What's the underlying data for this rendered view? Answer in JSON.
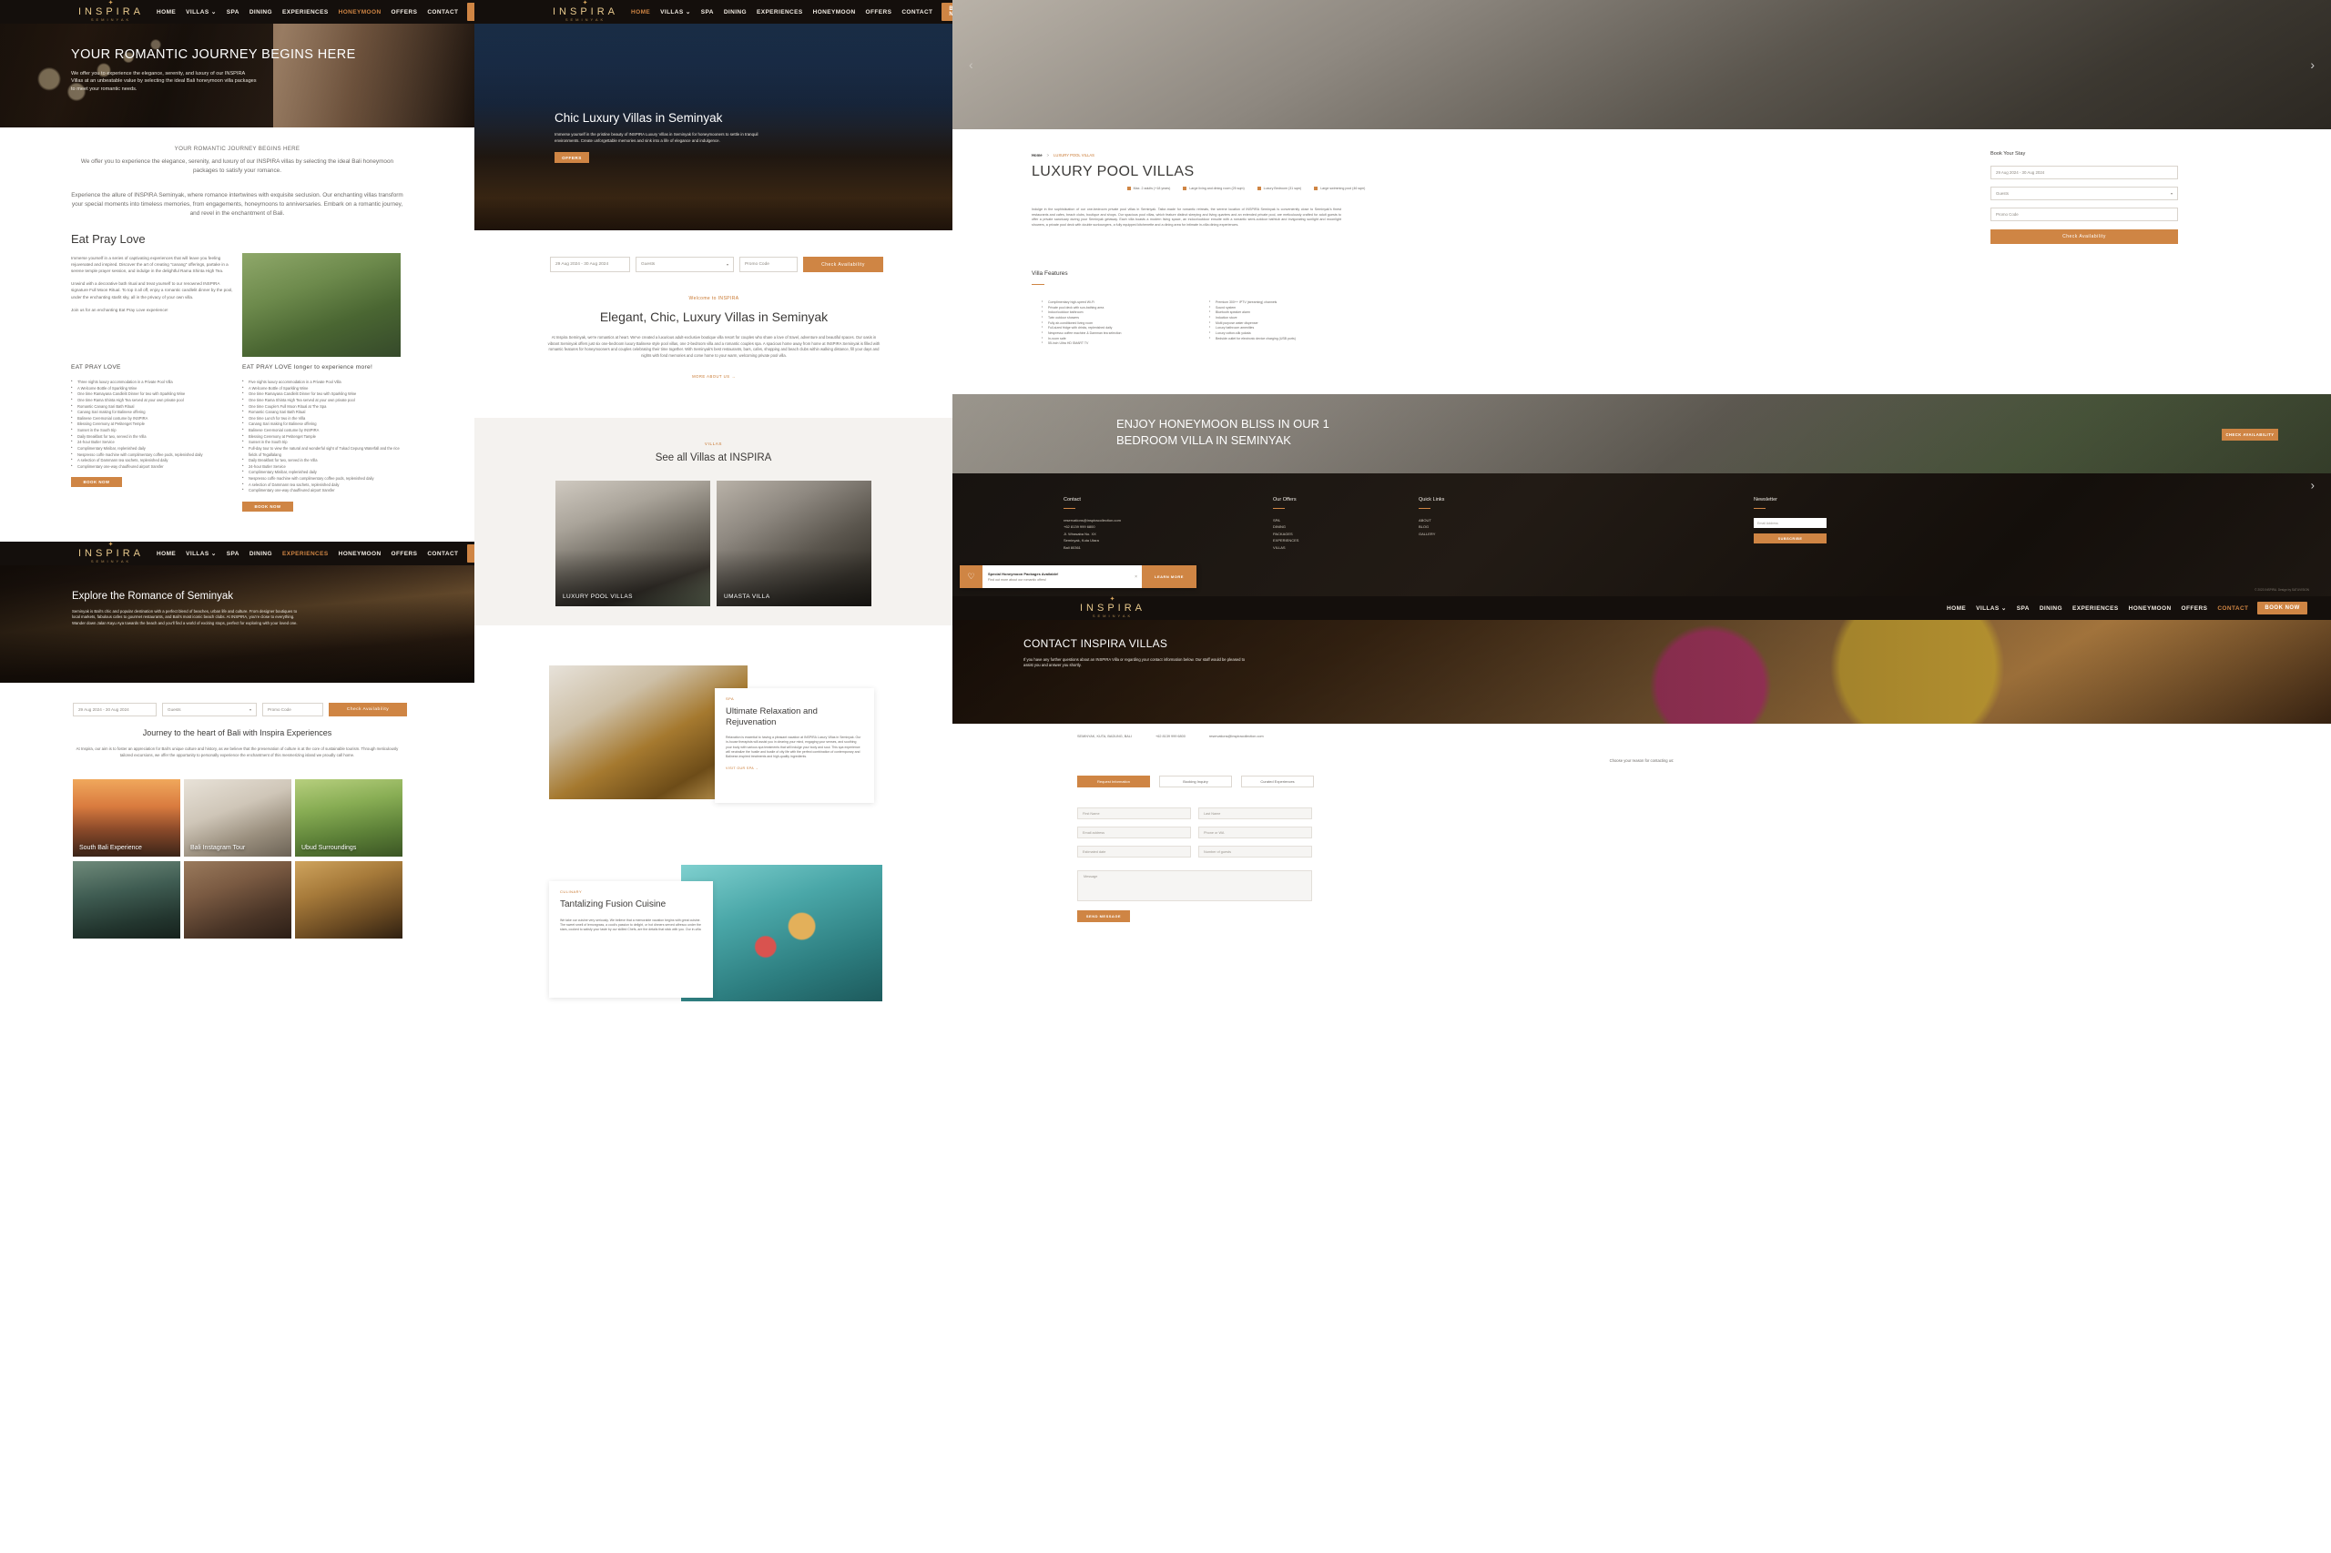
{
  "brand": {
    "name": "INSPIRA",
    "sub": "SEMINYAK",
    "mark": "✦"
  },
  "nav": {
    "items": [
      "HOME",
      "VILLAS",
      "SPA",
      "DINING",
      "EXPERIENCES",
      "HONEYMOON",
      "OFFERS",
      "CONTACT"
    ],
    "book_label": "BOOK NOW"
  },
  "panel_honeymoon": {
    "hero": {
      "title": "YOUR ROMANTIC JOURNEY BEGINS HERE",
      "paragraph": "We offer you to experience the elegance, serenity, and luxury of our INSPIRA Villas at an unbeatable value by selecting the ideal Bali honeymoon villa packages to meet your romantic needs."
    },
    "intro": {
      "eyebrow": "YOUR ROMANTIC JOURNEY BEGINS HERE",
      "p1": "We offer you to experience the elegance, serenity, and luxury of our INSPIRA villas by selecting the ideal Bali honeymoon packages to satisfy your romance.",
      "p2": "Experience the allure of INSPIRA Seminyak, where romance intertwines with exquisite seclusion. Our enchanting villas transform your special moments into timeless memories, from engagements, honeymoons to anniversaries. Embark on a romantic journey, and revel in the enchantment of Bali."
    },
    "eat_pray_love": {
      "heading": "Eat Pray Love",
      "p1": "Immerse yourself in a series of captivating experiences that will leave you feeling rejuvenated and inspired. Discover the art of creating \"canang\" offerings, partake in a serene temple prayer session, and indulge in the delightful Rama Shinta High Tea.",
      "p2": "Unwind with a decorative bath ritual and treat yourself to our renowned INSPIRA signature Full Moon Ritual. To top it all off, enjoy a romantic candlelit dinner by the pool, under the enchanting starlit sky, all in the privacy of your own villa.",
      "p3": "Join us for an enchanting Eat Pray Love experience!"
    },
    "package_a": {
      "title": "EAT PRAY LOVE",
      "items": [
        "Three nights luxury accommodation in a Private Pool Villa",
        "A Welcome Bottle of Sparkling Wine",
        "One time Ramayana Candlelit Dinner for two with Sparkling Wine",
        "One time Rama Shinta High Tea served at your own private pool",
        "Romantic Canang Sari Bath Ritual",
        "Canang Sari making for Balinese offering",
        "Balinese Ceremonial costume by INSPIRA",
        "Blessing Ceremony at Petitenget Temple",
        "Sunset in the South trip",
        "Daily Breakfast for two, served in the Villa",
        "24-hour Butler Service",
        "Complimentary Minibar, replenished daily",
        "Nespresso coffe machine with complimentary coffee pods, replenished daily",
        "A selection of Dammann tea sachets, replenished daily",
        "Complimentary one-way chauffeured airport transfer"
      ],
      "button": "BOOK NOW"
    },
    "package_b": {
      "title": "EAT PRAY LOVE longer to experience more!",
      "items": [
        "Five nights luxury accommodation in a Private Pool Villa",
        "A Welcome Bottle of Sparkling Wine",
        "One time Ramayana Candlelit Dinner for two with Sparkling Wine",
        "One time Rama Shinta High Tea served at your own private pool",
        "One time Couple's Full Moon Ritual at The Spa",
        "Romantic Canang Sari Bath Ritual",
        "One time Lunch for two in the Villa",
        "Canang Sari making for Balinese offering",
        "Balinese Ceremonial costume by INSPIRA",
        "Blessing Ceremony at Petitenget Tample",
        "Sunset in the South trip",
        "Full-day tour to view the natural and wonderful sight of Tukad Cepung Waterfall and the rice fields of Tegallalang",
        "Daily Breakfast for two, served in the Villa",
        "24-hour Butler Service",
        "Complimentary Minibar, replenished daily",
        "Nespresso coffe machine with complimentary coffee pods, replenished daily",
        "A selection of Dammann tea sachets, replenished daily",
        "Complimentary one-way chauffeured airport transfer"
      ],
      "button": "BOOK NOW"
    }
  },
  "panel_experiences": {
    "hero": {
      "title": "Explore the Romance of Seminyak",
      "paragraph": "Seminyak is Bali's chic and popular destination with a perfect blend of beaches, urban life and culture. From designer boutiques to local markets, fabulous cafes to gourmet restaurants, and Bali's most iconic beach clubs. At INSPIRA, you're close to everything. Wander down Jalan Kayu Aya towards the beach and you'll find a world of exciting stops, perfect for exploring with your loved one."
    },
    "booking": {
      "dates": "29 Aug 2024 - 30 Aug 2024",
      "guests": "Guests",
      "promo": "Promo Code",
      "submit": "Check Availability"
    },
    "section": {
      "heading": "Journey to the heart of Bali with Inspira Experiences",
      "paragraph": "At Inspira, our aim is to foster an appreciation for Bali's unique culture and history, as we believe that the preservation of culture is at the core of sustainable tourism. Through meticulously tailored excursions, we offer the opportunity to personally experience the enchantment of this mesmerizing island we proudly call home."
    },
    "cards": [
      {
        "title": "South Bali Experience",
        "art": "ph-sunset"
      },
      {
        "title": "Bali Instagram Tour",
        "art": "ph-wed"
      },
      {
        "title": "Ubud Surroundings",
        "art": "ph-rice"
      },
      {
        "title": "",
        "art": "ph-water"
      },
      {
        "title": "",
        "art": "ph-couple"
      },
      {
        "title": "",
        "art": "ph-dancer"
      }
    ]
  },
  "panel_home": {
    "hero": {
      "title": "Chic Luxury Villas in Seminyak",
      "paragraph": "Immerse yourself in the pristine beauty of INSPIRA Luxury Villas in Seminyak for honeymooners to settle in tranquil environments. Create unforgettable memories and sink into a life of elegance and indulgence.",
      "cta": "OFFERS"
    },
    "booking": {
      "dates": "29 Aug 2024 - 30 Aug 2024",
      "guests": "Guests",
      "promo": "Promo Code",
      "submit": "Check Availability"
    },
    "welcome": {
      "eyebrow": "Welcome to INSPIRA",
      "heading": "Elegant, Chic, Luxury Villas in Seminyak",
      "paragraph": "At Inspira Seminyak, we're romantics at heart. We've created a luxurious adult-exclusive boutique villa resort for couples who share a love of travel, adventure and beautiful spaces. Our oasis in vibrant Seminyak offers just six one-bedroom luxury Balinese style pool villas, one 2-bedroom villa and a romantic couples spa. A spacious home away from home at INSPIRA Seminyak is filled with romantic features for honeymooners and couples celebrating their time together. With Seminyak's best restaurants, bars, cafes, shopping and beach clubs within walking distance, fill your days and nights with fond memories and come home to your warm, welcoming private pool villa.",
      "link": "MORE ABOUT US  →"
    },
    "villas": {
      "eyebrow": "VILLAS",
      "heading": "See all Villas at INSPIRA",
      "cards": [
        {
          "title": "LUXURY POOL VILLAS",
          "art": "ph-room"
        },
        {
          "title": "UMASTA VILLA",
          "art": "ph-bed"
        }
      ]
    },
    "spa": {
      "eyebrow": "SPA",
      "heading": "Ultimate Relaxation and Rejuvenation",
      "paragraph": "Relaxation is essential to having a pleasant vacation at INSPIRA Luxury Villas in Seminyak. Our in-house therapists will assist you in clearing your mind, engaging your senses, and soothing your body with various spa treatments that will indulge your body and soul. This spa experience will neutralize the hustle and bustle of city life with the perfect combination of contemporary and Balinese-inspired treatments and high-quality ingredients.",
      "link": "VISIT OUR SPA  →"
    },
    "dining": {
      "eyebrow": "CULINARY",
      "heading": "Tantalizing Fusion Cuisine",
      "paragraph": "We take our cuisine very seriously. We believe that a memorable vacation begins with great cuisine. The sweet smell of lemongrass, a cook's passion to delight, or hot dinners served alfresco under the stars, cooked to satisfy your taste by our skilled Chefs, are the details that stick with you. Our in-villa"
    }
  },
  "panel_villa": {
    "breadcrumb": {
      "home": "Home",
      "sep": ">",
      "current": "LUXURY POOL VILLAS"
    },
    "title": "LUXURY POOL VILLAS",
    "specs": [
      "Max. 2 adults (+18 years)",
      "Large living and dining room (25 sqm)",
      "Luxury Bedroom (31 sqm)",
      "Large swimming pool (46 sqm)"
    ],
    "description": "Indulge in the sophistication of our one-bedroom private pool villas in Seminyak. Tailor-made for romantic retreats, the serene location of INSPIRA Seminyak is conveniently close to Seminyak's finest restaurants and cafes, beach clubs, boutique and shops. Our spacious pool villas, which feature distinct sleeping and living quarters and an extended private pool, are meticulously crafted for adult guests to offer a private sanctuary during your Seminyak getaway. Each villa boasts a modern living space, an indoor/outdoor ensuite with a romantic semi-outdoor bathtub and invigorating sunlight and moonlight showers, a private pool deck with double sunloungers, a fully equipped kitchenette and a dining area for intimate in-villa dining experiences.",
    "features_heading": "Villa Features",
    "features_left": [
      "Complimentary high-speed Wi-Fi",
      "Private pool deck with sun-bathing area",
      "Indoor/outdoor bathroom",
      "Twin outdoor showers",
      "Fully air-conditioned living room",
      "Full-sized fridge with drinks, replenished daily",
      "Nespresso coffee machine & Damman tea selection",
      "In-room safe",
      "55-inch Ultra HD SMART TV"
    ],
    "features_right": [
      "Premium 300++ IPTV (streaming) channels",
      "Sound system",
      "Bluetooth speaker alarm",
      "Induction stove",
      "Multi purpose water dispenser",
      "Luxury bathroom amenities",
      "Luxury cotton-silk yukata",
      "Bedside outlet for electronic device charging (USB ports)"
    ],
    "booking": {
      "heading": "Book Your Stay",
      "dates": "29 Aug 2024 - 30 Aug 2024",
      "guests": "Guests",
      "promo": "Promo Code",
      "submit": "Check Availability"
    }
  },
  "panel_banner": {
    "line1": "ENJOY HONEYMOON BLISS IN OUR 1",
    "line2": "BEDROOM VILLA IN SEMINYAK",
    "cta": "CHECK AVAILABILITY"
  },
  "footer": {
    "columns": [
      {
        "heading": "Contact",
        "items": [
          "reservations@inspiracollection.com",
          "+62 8139 999 6800",
          "Jl. Wirasaba No. XX",
          "Seminyak, Kuta Utara",
          "Bali 80361"
        ]
      },
      {
        "heading": "Our Offers",
        "items": [
          "SPA",
          "DINING",
          "PACKAGES",
          "EXPERIENCES",
          "VILLAS"
        ]
      },
      {
        "heading": "Quick Links",
        "items": [
          "ABOUT",
          "BLOG",
          "GALLERY"
        ]
      }
    ],
    "newsletter": {
      "heading": "Newsletter",
      "placeholder": "Email Address",
      "button": "SUBSCRIBE"
    },
    "copyright": "© 2023 INSPIRA. Design by SATUVISION"
  },
  "promo_bar": {
    "icon": "heart-icon",
    "title": "Special Honeymoon Packages Available!",
    "subtitle": "Find out more about our romantic offers!",
    "button": "LEARN MORE",
    "close": "×"
  },
  "panel_contact": {
    "hero": {
      "title": "CONTACT INSPIRA VILLAS",
      "paragraph": "If you have any further questions about an INSPIRA Villa or regarding your contact information below. Our staff would be pleased to assist you and answer you shortly."
    },
    "address_line": "SEMINYAK, KUTA, BADUNG, BALI",
    "phone": "+62 8139 999 6800",
    "email": "reservations@inspiracollection.com",
    "reason_label": "Choose your reason for contacting us:",
    "reasons": [
      "Request Information",
      "Booking Inquiry",
      "Curated Experiences"
    ],
    "form": {
      "first_name": "First Name",
      "last_name": "Last Name",
      "email": "Email address",
      "phone": "Phone or WA",
      "date": "Estimated date",
      "guests": "Number of guests",
      "message": "Message",
      "submit": "SEND MESSAGE"
    }
  },
  "colors": {
    "accent": "#cf8544",
    "accent_text": "#c8772f",
    "dark": "#120f0d",
    "body_text": "#6d6a67"
  }
}
